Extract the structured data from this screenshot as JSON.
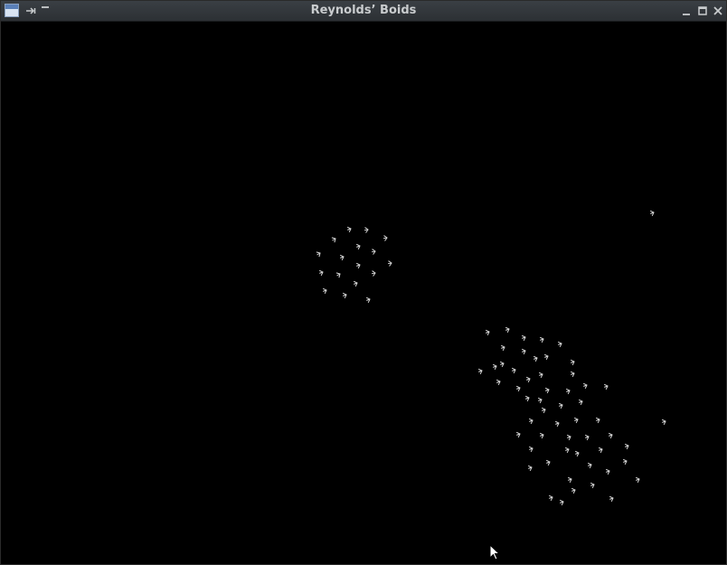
{
  "window": {
    "title": "Reynolds’ Boids",
    "icons": [
      "app-icon",
      "pin-icon",
      "shade-icon",
      "minimize-icon",
      "maximize-icon",
      "close-icon"
    ]
  },
  "scene": {
    "background": "#000000",
    "boid_color": "#d8d8d8"
  }
}
